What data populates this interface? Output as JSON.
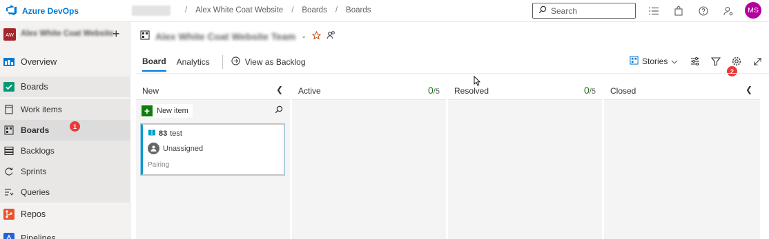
{
  "topbar": {
    "brand": "Azure DevOps",
    "breadcrumbs": [
      "Alex White Coat Website",
      "Boards",
      "Boards"
    ],
    "search_placeholder": "Search",
    "avatar_initials": "MS",
    "avatar_color": "#b4009e"
  },
  "project": {
    "badge": "AW",
    "name": "Alex White Coat Website",
    "badge_color": "#a4262c"
  },
  "nav": {
    "overview": "Overview",
    "boards": "Boards",
    "work_items": "Work items",
    "boards_sub": "Boards",
    "backlogs": "Backlogs",
    "sprints": "Sprints",
    "queries": "Queries",
    "repos": "Repos",
    "pipelines": "Pipelines"
  },
  "markers": {
    "first": "1",
    "second": "2"
  },
  "header": {
    "team_name": "Alex White Coat Website Team",
    "tabs": [
      "Board",
      "Analytics"
    ],
    "view_as_backlog": "View as Backlog",
    "backlog_level": "Stories"
  },
  "columns": [
    {
      "title": "New",
      "wip_current": "",
      "wip_limit": ""
    },
    {
      "title": "Active",
      "wip_current": "0",
      "wip_limit": "/5"
    },
    {
      "title": "Resolved",
      "wip_current": "0",
      "wip_limit": "/5"
    },
    {
      "title": "Closed",
      "wip_current": "",
      "wip_limit": ""
    }
  ],
  "new_item_label": "New item",
  "card": {
    "id": "83",
    "title": "test",
    "assignee": "Unassigned",
    "tag": "Pairing",
    "accent_color": "#009ccc"
  },
  "colors": {
    "accent": "#0078d4",
    "wip": "#107c10",
    "marker": "#e83a3a"
  }
}
